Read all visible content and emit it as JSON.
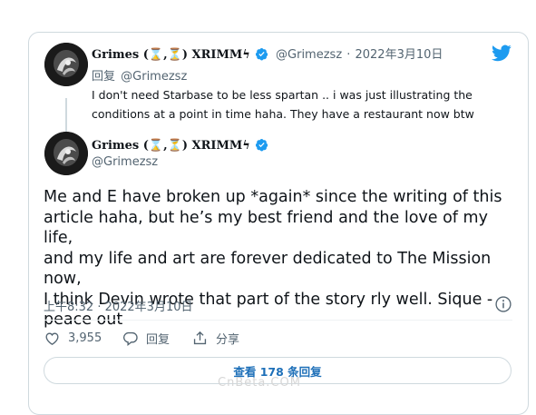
{
  "reply_tweet": {
    "display_name": "Grimes (",
    "display_name_glyph1": "⌛",
    "display_name_sep": ",",
    "display_name_glyph2": "⏳",
    "display_name_end": ") XRIMMϟ",
    "handle": "@Grimezsz",
    "separator": "·",
    "date": "2022年3月10日",
    "reply_label": "回复",
    "reply_to": "@Grimezsz",
    "text_line1": "I don't need Starbase to be less spartan ..  i was just illustrating the",
    "text_line2": "conditions at a point in time haha.  They have a restaurant now btw"
  },
  "main_tweet": {
    "display_name": "Grimes (",
    "display_name_glyph1": "⌛",
    "display_name_sep": ",",
    "display_name_glyph2": "⏳",
    "display_name_end": ") XRIMMϟ",
    "handle": "@Grimezsz",
    "lines": [
      "Me and E have broken up *again* since the writing of this",
      "article haha, but he’s my best friend and the love of my life,",
      "and my life and art are forever dedicated to The Mission now,",
      "I think Devin wrote that part of the story rly well.   Sique -",
      "peace out"
    ],
    "timestamp": "上午8:32 · 2022年3月10日",
    "like_count": "3,955",
    "reply_label": "回复",
    "share_label": "分享",
    "view_replies_label": "查看 178 条回复"
  },
  "watermark": "CnBeta.COM",
  "icons": {
    "brand": "twitter-bird-icon",
    "verified": "verified-badge-icon",
    "info": "info-icon",
    "like": "heart-icon",
    "reply": "speech-bubble-icon",
    "share": "share-icon"
  },
  "colors": {
    "twitter_blue": "#1d9bf0",
    "link_blue": "#1d6fb8",
    "secondary_text": "#536471",
    "border": "#cfd9de"
  }
}
